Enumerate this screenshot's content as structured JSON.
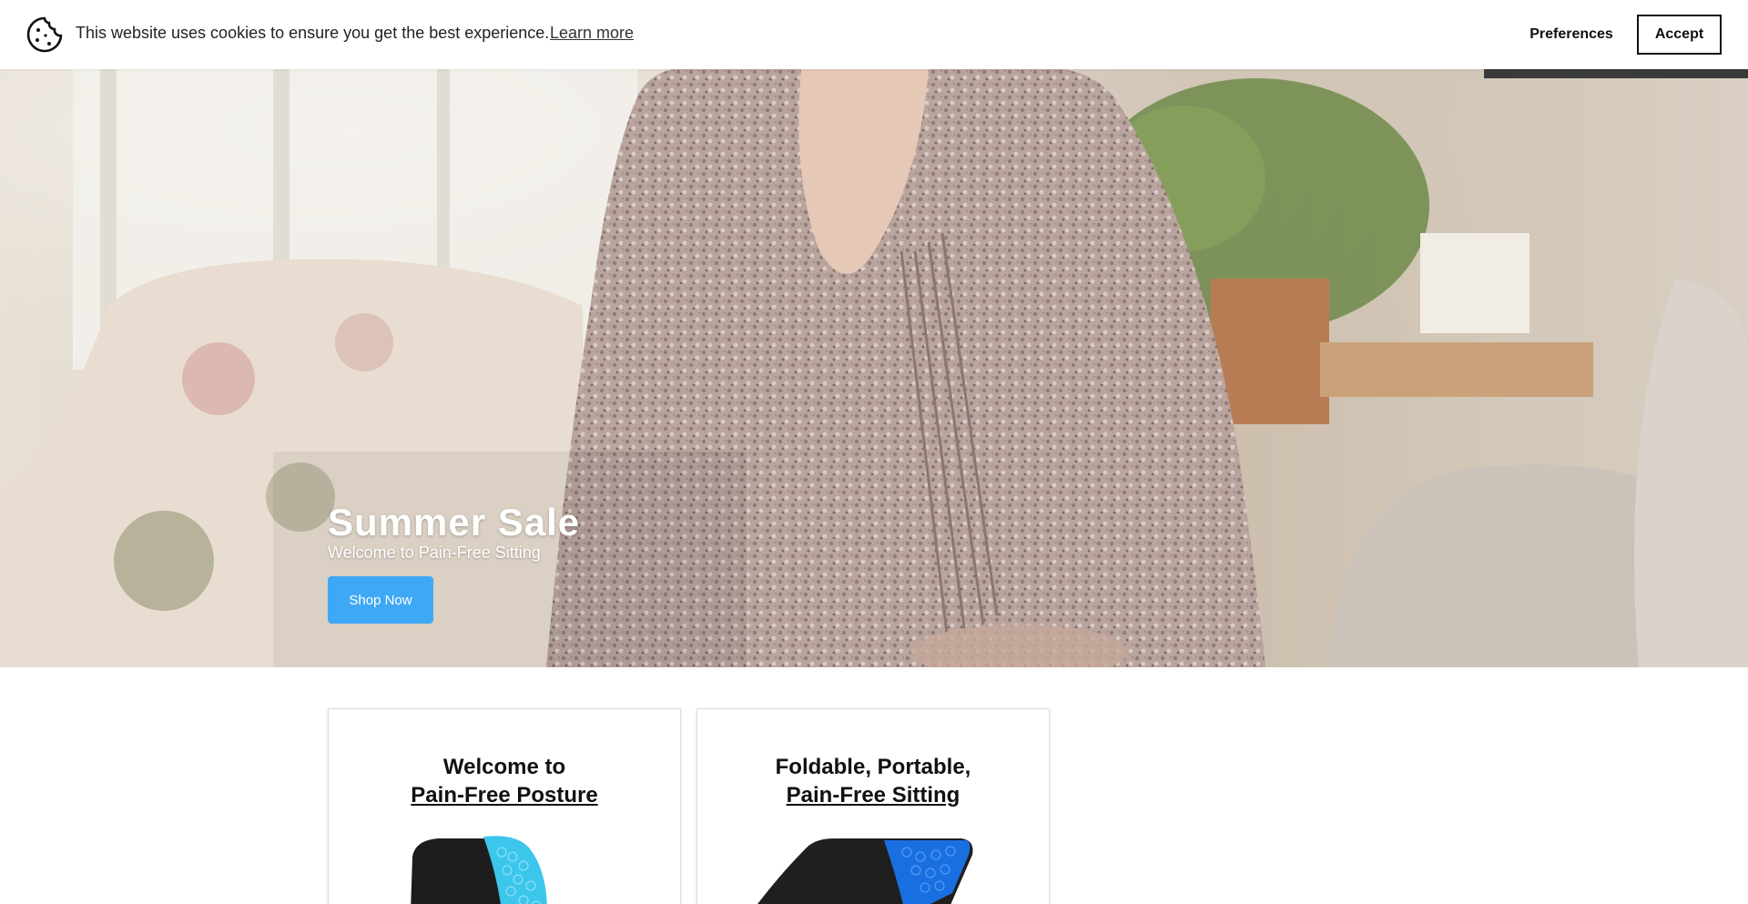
{
  "cookie_banner": {
    "message": "This website uses cookies to ensure you get the best experience.",
    "learn_more": "Learn more",
    "preferences": "Preferences",
    "accept": "Accept",
    "icon": "cookie-icon"
  },
  "hero": {
    "title": "Summer Sale",
    "subtitle": "Welcome to Pain-Free Sitting",
    "cta": "Shop Now",
    "cta_color": "#3fa8f5"
  },
  "cards": [
    {
      "line1": "Welcome to",
      "line2": "Pain-Free Posture",
      "image": "gel-back-cushion-image"
    },
    {
      "line1": "Foldable, Portable,",
      "line2": "Pain-Free Sitting",
      "image": "gel-seat-cushion-image"
    }
  ]
}
